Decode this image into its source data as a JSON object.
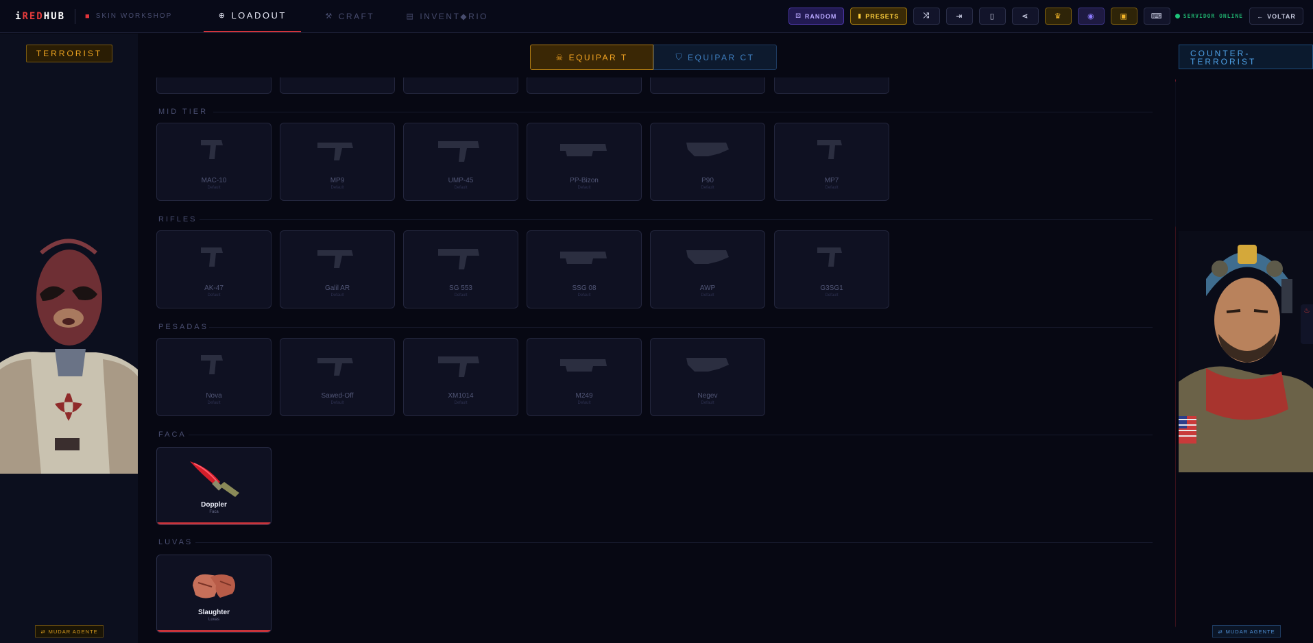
{
  "brand": {
    "logo_prefix": "i",
    "logo_red": "RED",
    "logo_suffix": "HUB",
    "workshop": "SKIN WORKSHOP"
  },
  "nav": [
    {
      "label": "LOADOUT",
      "icon": "target-icon",
      "active": true
    },
    {
      "label": "CRAFT",
      "icon": "hammer-icon",
      "active": false
    },
    {
      "label": "INVENT◆RIO",
      "icon": "box-icon",
      "active": false
    }
  ],
  "toolbar": {
    "random": "RANDOM",
    "presets": "PRESETS",
    "status": "SERVIDOR ONLINE",
    "back": "VOLTAR"
  },
  "left": {
    "team": "TERRORIST",
    "change": "MUDAR AGENTE"
  },
  "right": {
    "team": "COUNTER-TERRORIST",
    "change": "MUDAR AGENTE"
  },
  "equip": {
    "t": "EQUIPAR T",
    "ct": "EQUIPAR CT"
  },
  "sections": [
    {
      "title": "MID TIER",
      "items": [
        {
          "name": "MAC-10",
          "sub": "Default"
        },
        {
          "name": "MP9",
          "sub": "Default"
        },
        {
          "name": "UMP-45",
          "sub": "Default"
        },
        {
          "name": "PP-Bizon",
          "sub": "Default"
        },
        {
          "name": "P90",
          "sub": "Default"
        },
        {
          "name": "MP7",
          "sub": "Default"
        }
      ]
    },
    {
      "title": "RIFLES",
      "items": [
        {
          "name": "AK-47",
          "sub": "Default"
        },
        {
          "name": "Galil AR",
          "sub": "Default"
        },
        {
          "name": "SG 553",
          "sub": "Default"
        },
        {
          "name": "SSG 08",
          "sub": "Default"
        },
        {
          "name": "AWP",
          "sub": "Default"
        },
        {
          "name": "G3SG1",
          "sub": "Default"
        }
      ]
    },
    {
      "title": "PESADAS",
      "items": [
        {
          "name": "Nova",
          "sub": "Default"
        },
        {
          "name": "Sawed-Off",
          "sub": "Default"
        },
        {
          "name": "XM1014",
          "sub": "Default"
        },
        {
          "name": "M249",
          "sub": "Default"
        },
        {
          "name": "Negev",
          "sub": "Default"
        }
      ]
    },
    {
      "title": "FACA",
      "items": [
        {
          "name": "Doppler",
          "sub": "Faca"
        }
      ]
    },
    {
      "title": "LUVAS",
      "items": [
        {
          "name": "Slaughter",
          "sub": "Luvas"
        }
      ]
    }
  ],
  "colors": {
    "accent_red": "#d2343b",
    "t_gold": "#f5a623",
    "ct_blue": "#3f7fc0",
    "online_green": "#1ec47a"
  }
}
